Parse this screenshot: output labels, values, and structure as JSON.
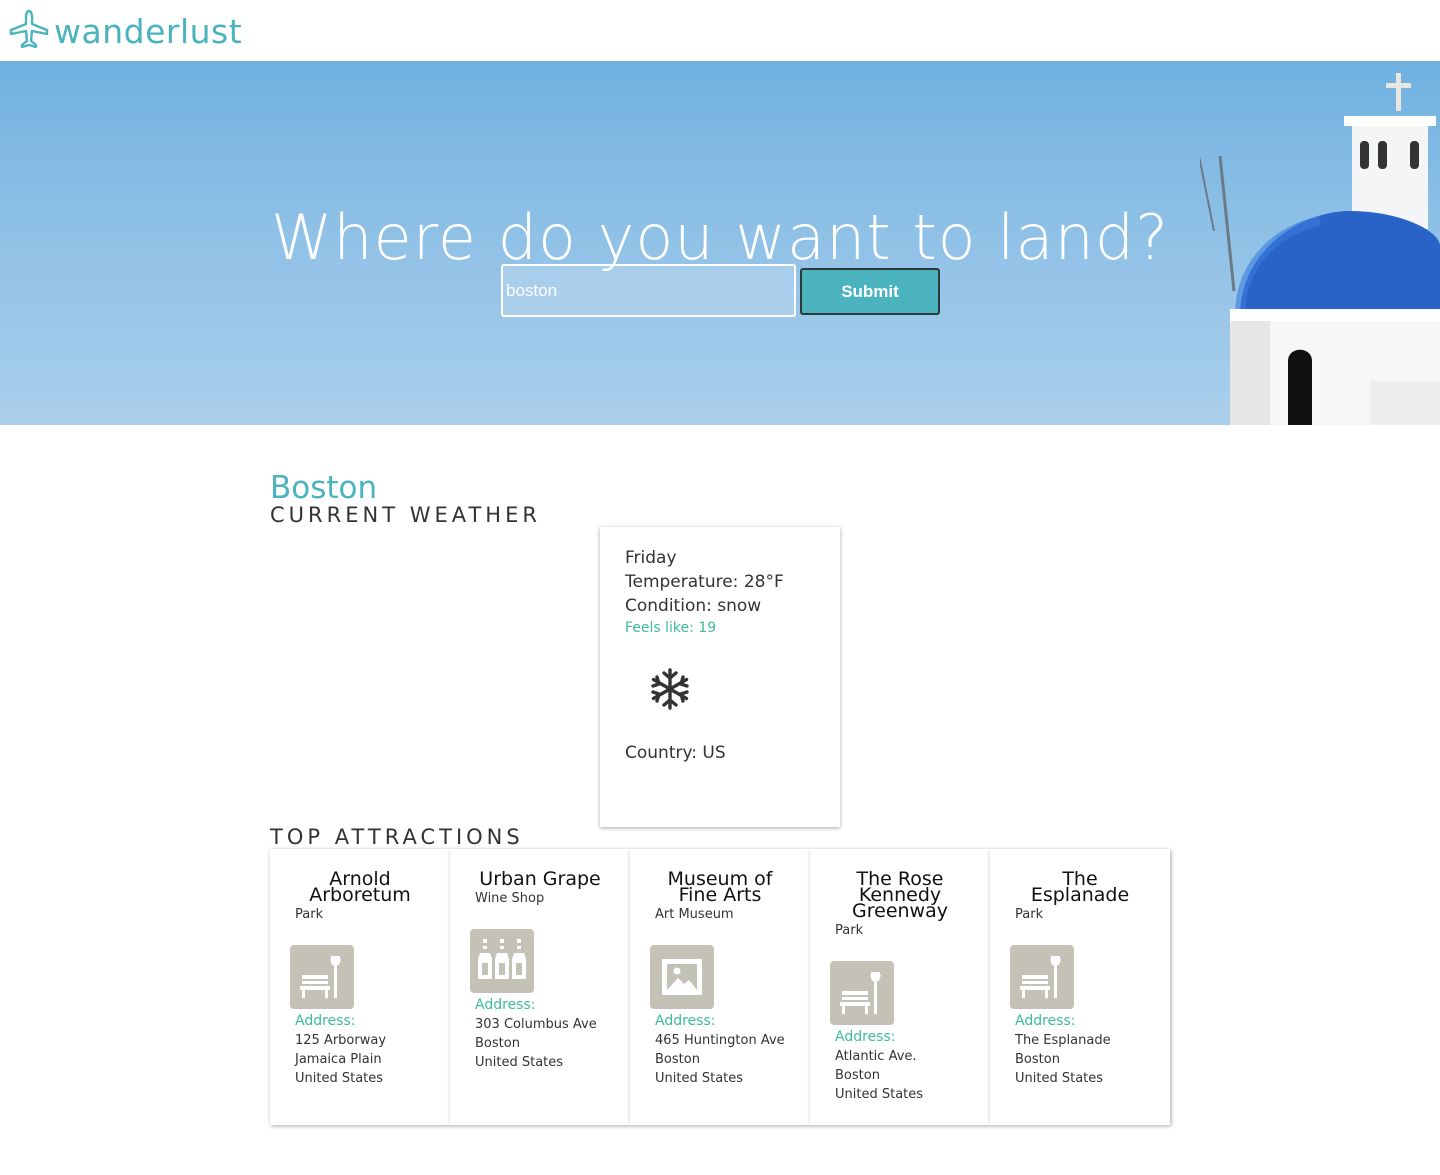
{
  "brand": {
    "name": "wanderlust",
    "color": "#4ab3be"
  },
  "hero": {
    "title": "Where do you want to land?",
    "search_value": "boston",
    "submit_label": "Submit"
  },
  "results": {
    "city": "Boston",
    "weather_heading": "CURRENT WEATHER",
    "weather": {
      "day": "Friday",
      "temperature": "Temperature: 28°F",
      "condition": "Condition: snow",
      "feels_like": "Feels like: 19",
      "icon": "snowflake-icon",
      "country": "Country: US"
    },
    "attractions_heading": "TOP ATTRACTIONS",
    "attractions": [
      {
        "name": "Arnold Arboretum",
        "type": "Park",
        "icon": "park-bench-icon",
        "address_label": "Address:",
        "address": [
          "125 Arborway",
          "Jamaica Plain",
          "United States"
        ]
      },
      {
        "name": "Urban Grape",
        "type": "Wine Shop",
        "icon": "wine-bottles-icon",
        "address_label": "Address:",
        "address": [
          "303 Columbus Ave",
          "Boston",
          "United States"
        ]
      },
      {
        "name": "Museum of Fine Arts",
        "type": "Art Museum",
        "icon": "picture-frame-icon",
        "address_label": "Address:",
        "address": [
          "465 Huntington Ave",
          "Boston",
          "United States"
        ]
      },
      {
        "name": "The Rose Kennedy Greenway",
        "type": "Park",
        "icon": "park-bench-icon",
        "address_label": "Address:",
        "address": [
          "Atlantic Ave.",
          "Boston",
          "United States"
        ]
      },
      {
        "name": "The Esplanade",
        "type": "Park",
        "icon": "park-bench-icon",
        "address_label": "Address:",
        "address": [
          "The Esplanade",
          "Boston",
          "United States"
        ]
      }
    ]
  }
}
